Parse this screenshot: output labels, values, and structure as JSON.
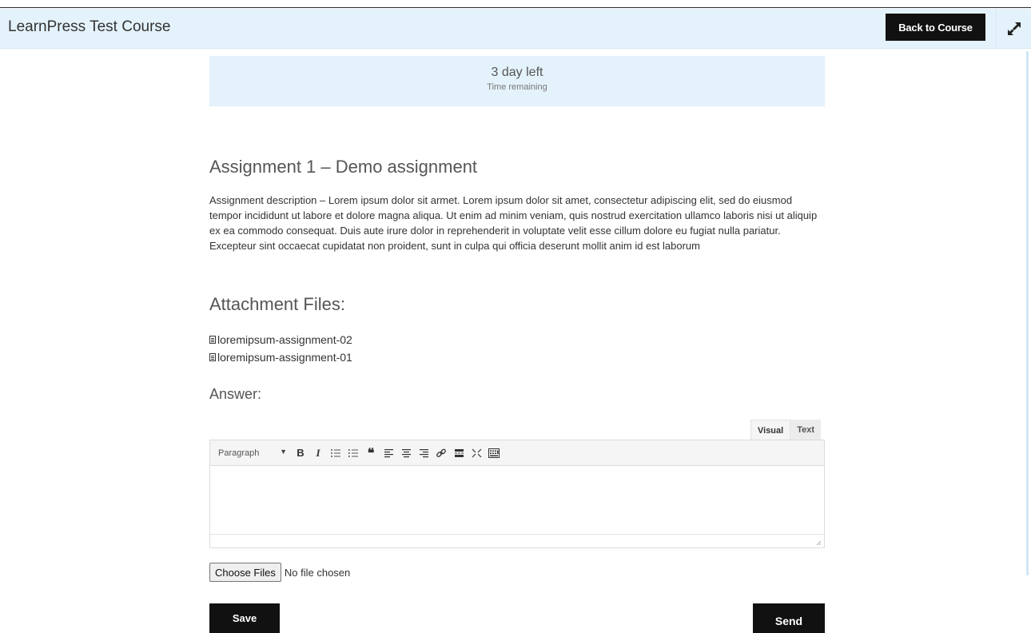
{
  "header": {
    "course_title": "LearnPress Test Course",
    "back_label": "Back to Course"
  },
  "timer": {
    "value": "3 day left",
    "label": "Time remaining"
  },
  "assignment": {
    "title": "Assignment 1 – Demo assignment",
    "description": "Assignment description – Lorem ipsum dolor sit armet. Lorem ipsum dolor sit amet, consectetur adipiscing elit, sed do eiusmod tempor incididunt ut labore et dolore magna aliqua. Ut enim ad minim veniam, quis nostrud exercitation ullamco laboris nisi ut aliquip ex ea commodo consequat. Duis aute irure dolor in reprehenderit in voluptate velit esse cillum dolore eu fugiat nulla pariatur. Excepteur sint occaecat cupidatat non proident, sunt in culpa qui officia deserunt mollit anim id est laborum"
  },
  "attachments": {
    "heading": "Attachment Files:",
    "files": [
      "loremipsum-assignment-02",
      "loremipsum-assignment-01"
    ]
  },
  "answer": {
    "heading": "Answer:",
    "tabs": [
      "Visual",
      "Text"
    ],
    "active_tab": "Visual",
    "format_value": "Paragraph",
    "toolbar_icons": [
      "bold-icon",
      "italic-icon",
      "bulleted-list-icon",
      "numbered-list-icon",
      "blockquote-icon",
      "align-left-icon",
      "align-center-icon",
      "align-right-icon",
      "link-icon",
      "read-more-icon",
      "fullscreen-icon",
      "toolbar-toggle-icon"
    ]
  },
  "upload": {
    "button_label": "Choose Files",
    "status": "No file chosen"
  },
  "actions": {
    "save_label": "Save",
    "send_label": "Send"
  },
  "colors": {
    "header_bg": "#e4f2fb",
    "button_bg": "#111111",
    "text": "#333333"
  }
}
